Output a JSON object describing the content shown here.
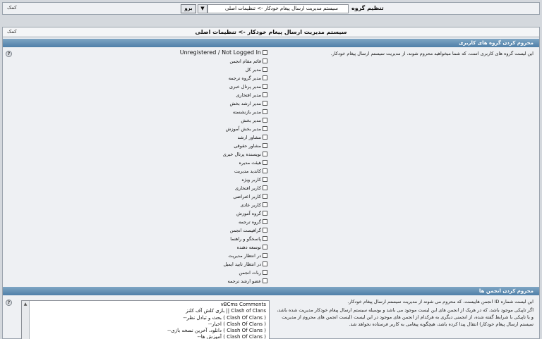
{
  "topbar": {
    "help_label": "کمک",
    "group_label": "تنظیم گروه",
    "selected_group": "سیستم مدیریت ارسال پیغام خودکار -> تنظیمات اصلی",
    "go_label": "برو"
  },
  "panel": {
    "title": "سیستم مدیریت ارسال پیغام خودکار -> تنظیمات اصلی",
    "help_label": "کمک"
  },
  "section1": {
    "title": "محروم کردن گروه های کاربری",
    "description": "این لیست گروه های کاربری است، که شما میخواهید محروم شوند، از مدیریت سیستم ارسال پیغام خودکار.",
    "help_icon": "?"
  },
  "groups": [
    "Unregistered / Not Logged In",
    "قائم مقام انجمن",
    "مدیر کل",
    "مدیر گروه ترجمه",
    "مدیر پرتال خبری",
    "مدیر افتخاری",
    "مدیر ارشد بخش",
    "مدیر بازنشسته",
    "مدیر بخش",
    "مدیر بخش آموزش",
    "مشاور ارشد",
    "مشاور حقوقی",
    "نویسنده پرتال خبری",
    "هیئت مدیره",
    "کاندید مدیریت",
    "کاربر ویژه",
    "کاربر افتخاری",
    "کاربر اعتراضی",
    "کاربر عادی",
    "گروه آموزش",
    "گروه ترجمه",
    "گرافیست انجمن",
    "پاسخگو و راهنما",
    "توسعه دهنده",
    "در انتظار مدیریت",
    "در انتظار تایید ایمیل",
    "ربات انجمن",
    "عضو ارشد ترجمه"
  ],
  "section2": {
    "title": "محروم کردن انجمن ها",
    "description_1": "این لیست شماره ID انجمن هاییست، که محروم می شوند از مدیریت سیستم ارسال پیغام خودکار.",
    "description_2": "اگر تاپیکی موجود باشد، که در هریک از انجمن های این لیست موجود می باشد و بوسیله سیستم ارسال پیغام خودکار مدیریت شده باشد، و یا تاپیکی با شرایط گفته شده، از انجمنی دیگری به هرکدام از انجمن های موجود در این لیست (لیست انجمن های محروم از مدیریت سیستم ارسال پیغام خودکار) انتقال پیدا کرده باشد، هیچگونه پیغامی به کاربر فرستاده نخواهد شد.",
    "help_icon": "?"
  },
  "forums": [
    "vBCms Comments",
    "بازی کلش آف کلنز || Clash of Clans",
    "--بحث و تبادل نظر ( Clash Of Clans )",
    "--اخبار ( Clash Of Clans )",
    "--دانلود، آخرین نسخه بازی ( Clash Of Clans )",
    "--آموزش ها ( Clash Of Clans )"
  ]
}
